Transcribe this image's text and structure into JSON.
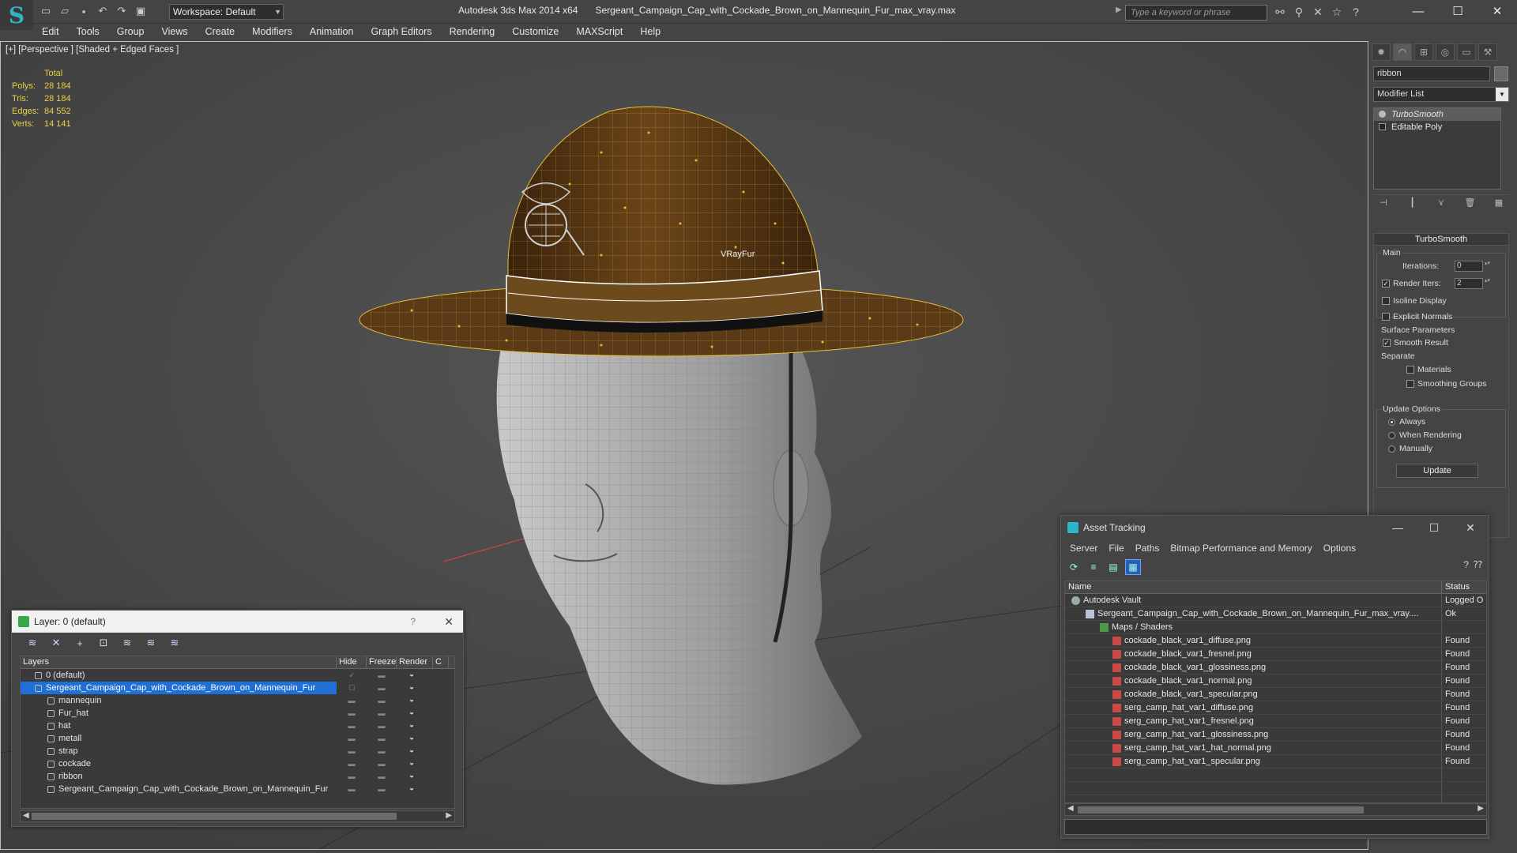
{
  "titlebar": {
    "app_title": "Autodesk 3ds Max  2014 x64",
    "file_title": "Sergeant_Campaign_Cap_with_Cockade_Brown_on_Mannequin_Fur_max_vray.max",
    "workspace": "Workspace: Default",
    "search_placeholder": "Type a keyword or phrase"
  },
  "menu": [
    "Edit",
    "Tools",
    "Group",
    "Views",
    "Create",
    "Modifiers",
    "Animation",
    "Graph Editors",
    "Rendering",
    "Customize",
    "MAXScript",
    "Help"
  ],
  "viewport": {
    "label": "[+] [Perspective ] [Shaded + Edged Faces ]",
    "stats": {
      "header": "Total",
      "rows": [
        {
          "key": "Polys:",
          "value": "28 184"
        },
        {
          "key": "Tris:",
          "value": "28 184"
        },
        {
          "key": "Edges:",
          "value": "84 552"
        },
        {
          "key": "Verts:",
          "value": "14 141"
        }
      ]
    },
    "object_label": "VRayFur",
    "colors": {
      "stats": "#e8d24a",
      "hat_fill": "#5b3a17",
      "wire": "#e6c23a",
      "background": "#4a4a4a"
    }
  },
  "command_panel": {
    "object_name": "ribbon",
    "modifier_list": "Modifier List",
    "stack": [
      {
        "label": "TurboSmooth",
        "selected": true
      },
      {
        "label": "Editable Poly",
        "selected": false
      }
    ],
    "turbosmooth": {
      "title": "TurboSmooth",
      "main_label": "Main",
      "iterations_label": "Iterations:",
      "iterations_value": "0",
      "render_iters_label": "Render Iters:",
      "render_iters_value": "2",
      "isoline_label": "Isoline Display",
      "explicit_label": "Explicit Normals",
      "surface_label": "Surface Parameters",
      "smooth_label": "Smooth Result",
      "separate_label": "Separate",
      "materials_label": "Materials",
      "smoothing_label": "Smoothing Groups",
      "update_options_label": "Update Options",
      "always_label": "Always",
      "when_rendering_label": "When Rendering",
      "manually_label": "Manually",
      "update_button": "Update"
    }
  },
  "layer_window": {
    "title": "Layer: 0 (default)",
    "help": "?",
    "columns": [
      "Layers",
      "Hide",
      "Freeze",
      "Render",
      "C"
    ],
    "rows": [
      {
        "name": "0 (default)",
        "indent": 0,
        "selected": false
      },
      {
        "name": "Sergeant_Campaign_Cap_with_Cockade_Brown_on_Mannequin_Fur",
        "indent": 0,
        "selected": true
      },
      {
        "name": "mannequin",
        "indent": 1,
        "selected": false
      },
      {
        "name": "Fur_hat",
        "indent": 1,
        "selected": false
      },
      {
        "name": "hat",
        "indent": 1,
        "selected": false
      },
      {
        "name": "metall",
        "indent": 1,
        "selected": false
      },
      {
        "name": "strap",
        "indent": 1,
        "selected": false
      },
      {
        "name": "cockade",
        "indent": 1,
        "selected": false
      },
      {
        "name": "ribbon",
        "indent": 1,
        "selected": false
      },
      {
        "name": "Sergeant_Campaign_Cap_with_Cockade_Brown_on_Mannequin_Fur",
        "indent": 1,
        "selected": false
      }
    ]
  },
  "asset_window": {
    "title": "Asset Tracking",
    "menu": [
      "Server",
      "File",
      "Paths",
      "Bitmap Performance and Memory",
      "Options"
    ],
    "columns": [
      "Name",
      "Status"
    ],
    "rows": [
      {
        "name": "Autodesk Vault",
        "status": "Logged O",
        "level": 0,
        "icon": "vault"
      },
      {
        "name": "Sergeant_Campaign_Cap_with_Cockade_Brown_on_Mannequin_Fur_max_vray....",
        "status": "Ok",
        "level": 1,
        "icon": "file"
      },
      {
        "name": "Maps / Shaders",
        "status": "",
        "level": 2,
        "icon": "maps"
      },
      {
        "name": "cockade_black_var1_diffuse.png",
        "status": "Found",
        "level": 3,
        "icon": "png"
      },
      {
        "name": "cockade_black_var1_fresnel.png",
        "status": "Found",
        "level": 3,
        "icon": "png"
      },
      {
        "name": "cockade_black_var1_glossiness.png",
        "status": "Found",
        "level": 3,
        "icon": "png"
      },
      {
        "name": "cockade_black_var1_normal.png",
        "status": "Found",
        "level": 3,
        "icon": "png"
      },
      {
        "name": "cockade_black_var1_specular.png",
        "status": "Found",
        "level": 3,
        "icon": "png"
      },
      {
        "name": "serg_camp_hat_var1_diffuse.png",
        "status": "Found",
        "level": 3,
        "icon": "png"
      },
      {
        "name": "serg_camp_hat_var1_fresnel.png",
        "status": "Found",
        "level": 3,
        "icon": "png"
      },
      {
        "name": "serg_camp_hat_var1_glossiness.png",
        "status": "Found",
        "level": 3,
        "icon": "png"
      },
      {
        "name": "serg_camp_hat_var1_hat_normal.png",
        "status": "Found",
        "level": 3,
        "icon": "png"
      },
      {
        "name": "serg_camp_hat_var1_specular.png",
        "status": "Found",
        "level": 3,
        "icon": "png"
      }
    ]
  }
}
